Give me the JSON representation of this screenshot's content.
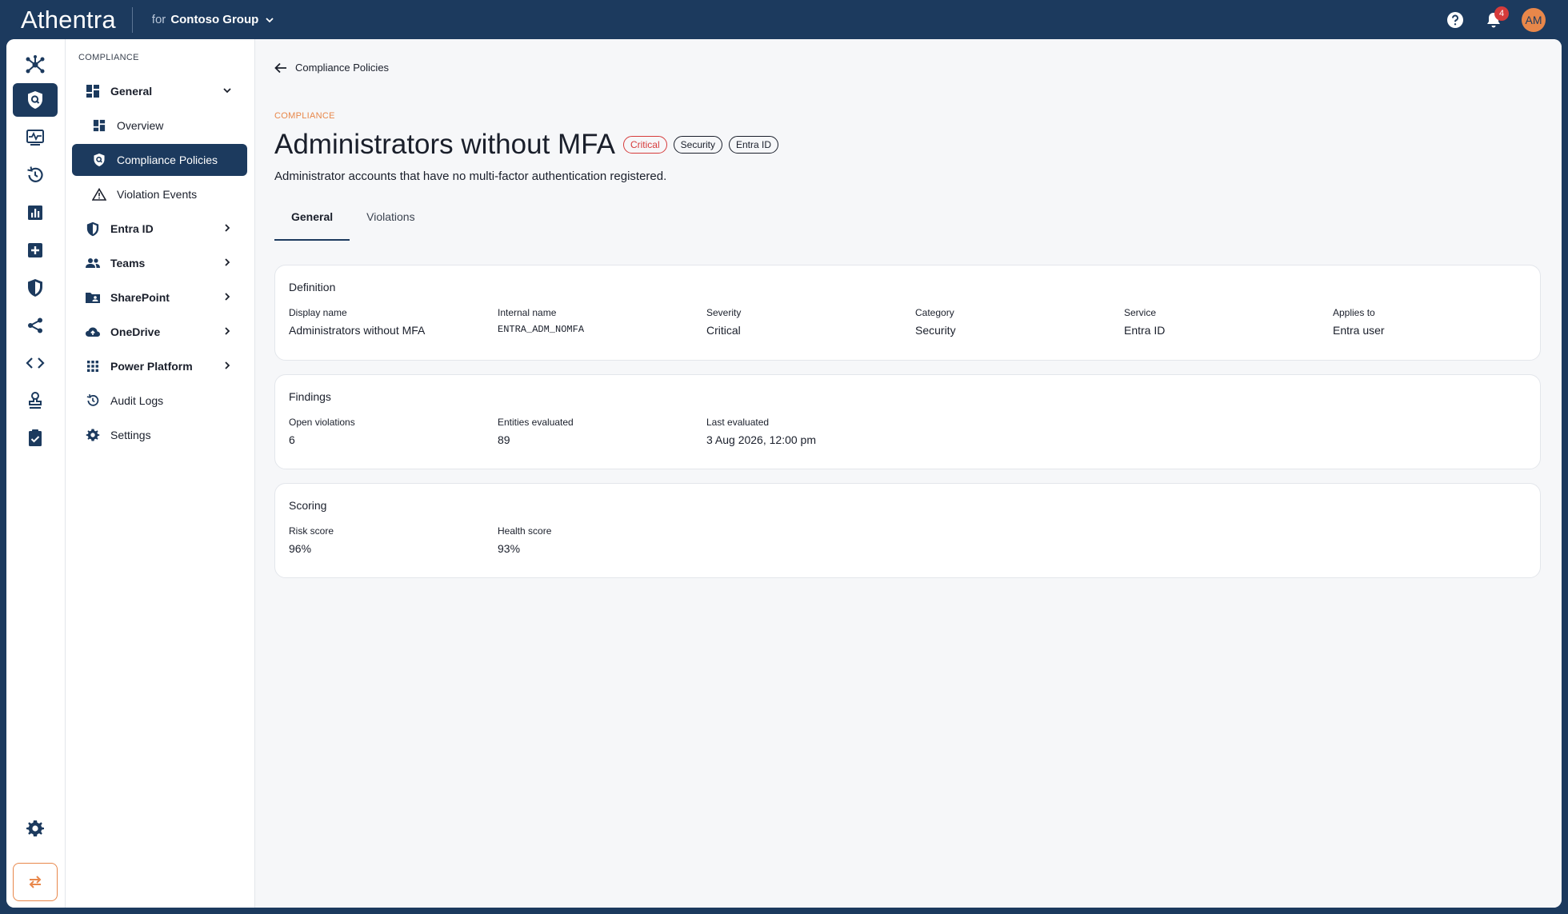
{
  "app": {
    "brand": "Athentra",
    "org_prefix": "for",
    "org_name": "Contoso Group",
    "notification_count": "4",
    "avatar_initials": "AM"
  },
  "subnav": {
    "heading": "COMPLIANCE",
    "items": [
      {
        "label": "General"
      },
      {
        "label": "Overview"
      },
      {
        "label": "Compliance Policies"
      },
      {
        "label": "Violation Events"
      },
      {
        "label": "Entra ID"
      },
      {
        "label": "Teams"
      },
      {
        "label": "SharePoint"
      },
      {
        "label": "OneDrive"
      },
      {
        "label": "Power Platform"
      },
      {
        "label": "Audit Logs"
      },
      {
        "label": "Settings"
      }
    ]
  },
  "page": {
    "back_label": "Compliance Policies",
    "eyebrow": "COMPLIANCE",
    "title": "Administrators without MFA",
    "tags": [
      "Critical",
      "Security",
      "Entra ID"
    ],
    "description": "Administrator accounts that have no multi-factor authentication registered.",
    "tabs": [
      "General",
      "Violations"
    ]
  },
  "definition": {
    "title": "Definition",
    "fields": [
      {
        "label": "Display name",
        "value": "Administrators without MFA"
      },
      {
        "label": "Internal name",
        "value": "ENTRA_ADM_NOMFA"
      },
      {
        "label": "Severity",
        "value": "Critical"
      },
      {
        "label": "Category",
        "value": "Security"
      },
      {
        "label": "Service",
        "value": "Entra ID"
      },
      {
        "label": "Applies to",
        "value": "Entra user"
      }
    ]
  },
  "findings": {
    "title": "Findings",
    "fields": [
      {
        "label": "Open violations",
        "value": "6"
      },
      {
        "label": "Entities evaluated",
        "value": "89"
      },
      {
        "label": "Last evaluated",
        "value": "3 Aug 2026, 12:00 pm"
      }
    ]
  },
  "scoring": {
    "title": "Scoring",
    "fields": [
      {
        "label": "Risk score",
        "value": "96%"
      },
      {
        "label": "Health score",
        "value": "93%"
      }
    ]
  },
  "colors": {
    "navy": "#1c3a5e",
    "accent": "#e8874a",
    "critical": "#d63b3b"
  }
}
